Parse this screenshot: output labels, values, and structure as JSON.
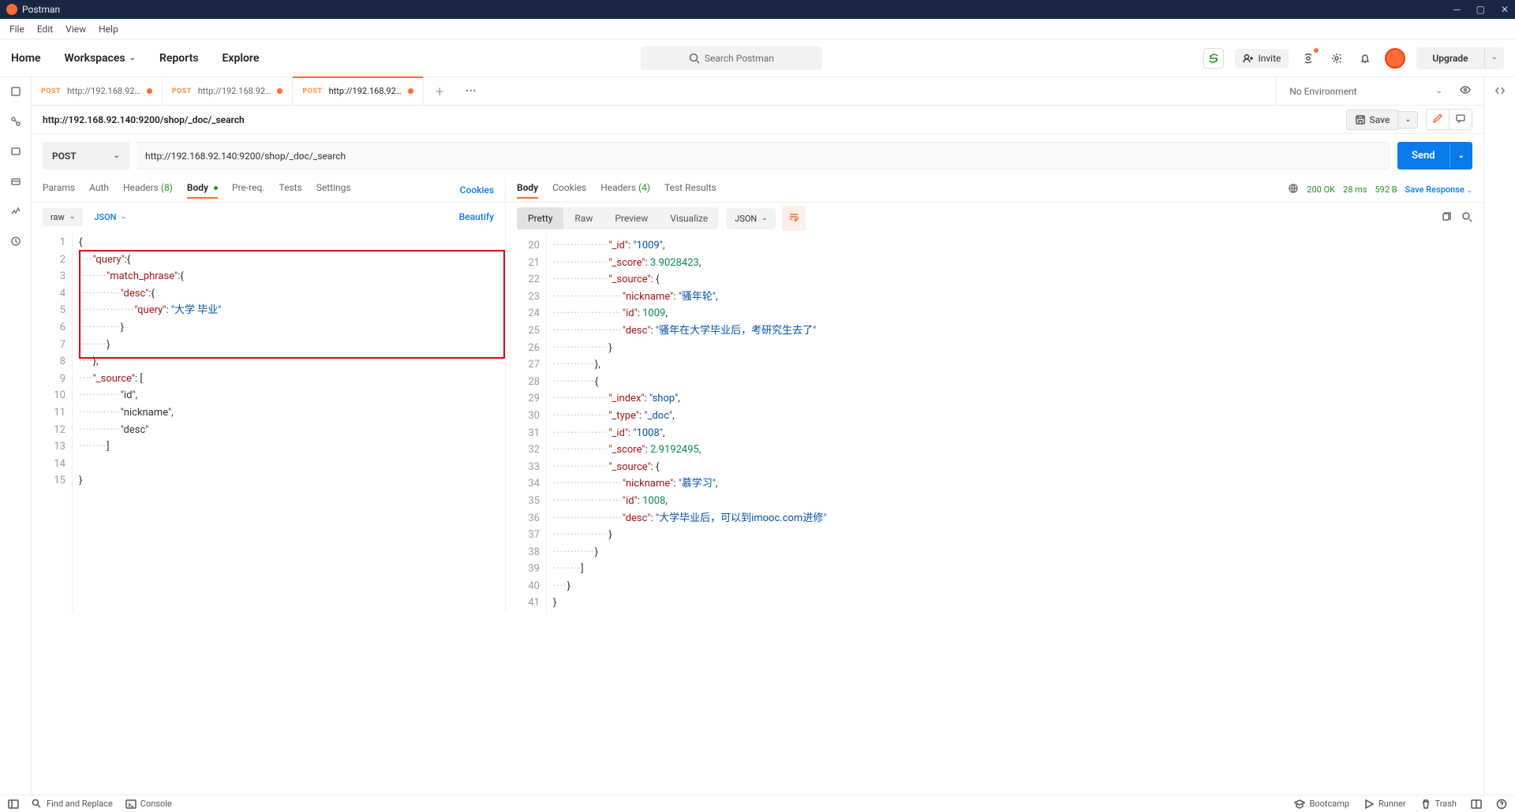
{
  "app": {
    "title": "Postman"
  },
  "menu": {
    "file": "File",
    "edit": "Edit",
    "view": "View",
    "help": "Help"
  },
  "header": {
    "home": "Home",
    "workspaces": "Workspaces",
    "reports": "Reports",
    "explore": "Explore",
    "search_placeholder": "Search Postman",
    "invite": "Invite",
    "upgrade": "Upgrade"
  },
  "tabs": [
    {
      "method": "POST",
      "title": "http://192.168.92…",
      "modified": true,
      "active": false
    },
    {
      "method": "POST",
      "title": "http://192.168.92…",
      "modified": true,
      "active": false
    },
    {
      "method": "POST",
      "title": "http://192.168.92…",
      "modified": true,
      "active": true
    }
  ],
  "env": {
    "selected": "No Environment"
  },
  "request": {
    "title": "http://192.168.92.140:9200/shop/_doc/_search",
    "save": "Save",
    "method": "POST",
    "url": "http://192.168.92.140:9200/shop/_doc/_search",
    "send": "Send"
  },
  "reqtabs": {
    "params": "Params",
    "auth": "Authorization",
    "headers": "Headers",
    "headers_count": "(8)",
    "body": "Body",
    "prereq": "Pre-req.",
    "tests": "Tests",
    "settings": "Settings",
    "cookies": "Cookies"
  },
  "bodybar": {
    "raw": "raw",
    "json": "JSON",
    "beautify": "Beautify"
  },
  "request_body_lines": [
    "{",
    "    \"query\":{",
    "        \"match_phrase\":{",
    "            \"desc\":{",
    "                \"query\": \"大学 毕业\"",
    "            }",
    "        }",
    "    },",
    "    \"_source\": [",
    "            \"id\",",
    "            \"nickname\",",
    "            \"desc\"",
    "        ]",
    "",
    "}"
  ],
  "resptabs": {
    "body": "Body",
    "cookies": "Cookies",
    "headers": "Headers",
    "headers_count": "(4)",
    "testresults": "Test Results"
  },
  "respmeta": {
    "status": "200 OK",
    "time": "28 ms",
    "size": "592 B",
    "save": "Save Response"
  },
  "respbar": {
    "pretty": "Pretty",
    "raw": "Raw",
    "preview": "Preview",
    "visualize": "Visualize",
    "json": "JSON"
  },
  "response_lines": [
    {
      "n": 20,
      "t": "                \"_id\": \"1009\","
    },
    {
      "n": 21,
      "t": "                \"_score\": 3.9028423,"
    },
    {
      "n": 22,
      "t": "                \"_source\": {"
    },
    {
      "n": 23,
      "t": "                    \"nickname\": \"骚年轮\","
    },
    {
      "n": 24,
      "t": "                    \"id\": 1009,"
    },
    {
      "n": 25,
      "t": "                    \"desc\": \"骚年在大学毕业后，考研究生去了\""
    },
    {
      "n": 26,
      "t": "                }"
    },
    {
      "n": 27,
      "t": "            },"
    },
    {
      "n": 28,
      "t": "            {"
    },
    {
      "n": 29,
      "t": "                \"_index\": \"shop\","
    },
    {
      "n": 30,
      "t": "                \"_type\": \"_doc\","
    },
    {
      "n": 31,
      "t": "                \"_id\": \"1008\","
    },
    {
      "n": 32,
      "t": "                \"_score\": 2.9192495,"
    },
    {
      "n": 33,
      "t": "                \"_source\": {"
    },
    {
      "n": 34,
      "t": "                    \"nickname\": \"慕学习\","
    },
    {
      "n": 35,
      "t": "                    \"id\": 1008,"
    },
    {
      "n": 36,
      "t": "                    \"desc\": \"大学毕业后，可以到imooc.com进修\""
    },
    {
      "n": 37,
      "t": "                }"
    },
    {
      "n": 38,
      "t": "            }"
    },
    {
      "n": 39,
      "t": "        ]"
    },
    {
      "n": 40,
      "t": "    }"
    },
    {
      "n": 41,
      "t": "}"
    }
  ],
  "statusbar": {
    "find": "Find and Replace",
    "console": "Console",
    "bootcamp": "Bootcamp",
    "runner": "Runner",
    "trash": "Trash"
  }
}
